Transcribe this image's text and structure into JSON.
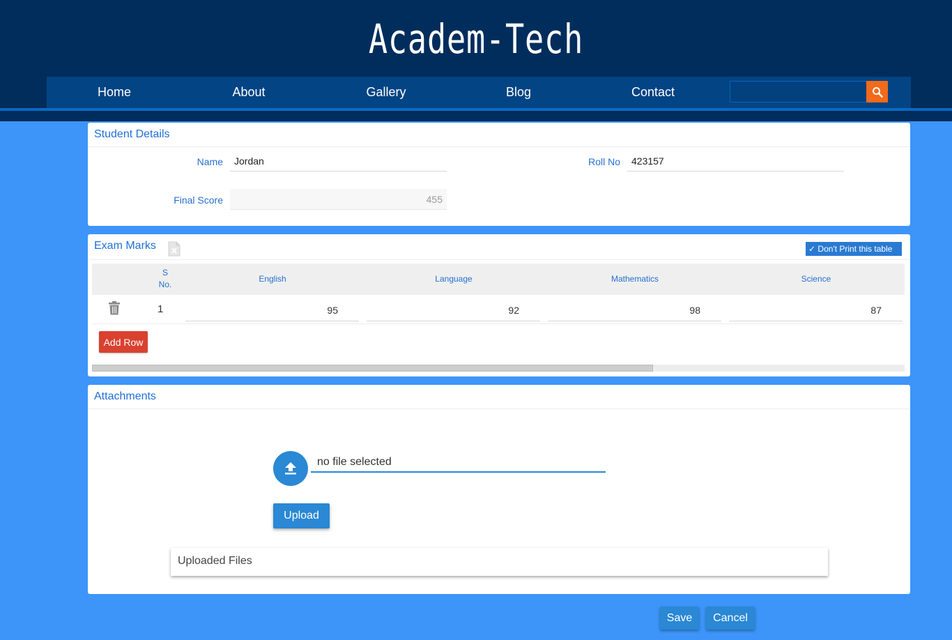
{
  "header": {
    "brand": "Academ-Tech",
    "nav": [
      "Home",
      "About",
      "Gallery",
      "Blog",
      "Contact"
    ],
    "search": {
      "value": "",
      "placeholder": "",
      "icon": "search-icon"
    }
  },
  "student_details": {
    "title": "Student Details",
    "name_label": "Name",
    "name_value": "Jordan",
    "roll_label": "Roll No",
    "roll_value": "423157",
    "score_label": "Final Score",
    "score_value": "455"
  },
  "exam_marks": {
    "title": "Exam Marks",
    "dont_print_label": "Don't Print this table",
    "columns": {
      "sno_line1": "S",
      "sno_line2": "No.",
      "english": "English",
      "language": "Language",
      "mathematics": "Mathematics",
      "science": "Science"
    },
    "rows": [
      {
        "sno": "1",
        "english": "95",
        "language": "92",
        "mathematics": "98",
        "science": "87"
      }
    ],
    "add_row_label": "Add Row"
  },
  "attachments": {
    "title": "Attachments",
    "file_status": "no file selected",
    "upload_label": "Upload",
    "uploaded_files_title": "Uploaded Files"
  },
  "footer": {
    "save_label": "Save",
    "cancel_label": "Cancel"
  },
  "colors": {
    "background": "#3d95f9",
    "header": "#012d5c",
    "accent": "#2a88d4",
    "danger": "#d9412f",
    "search": "#f26a1b"
  }
}
